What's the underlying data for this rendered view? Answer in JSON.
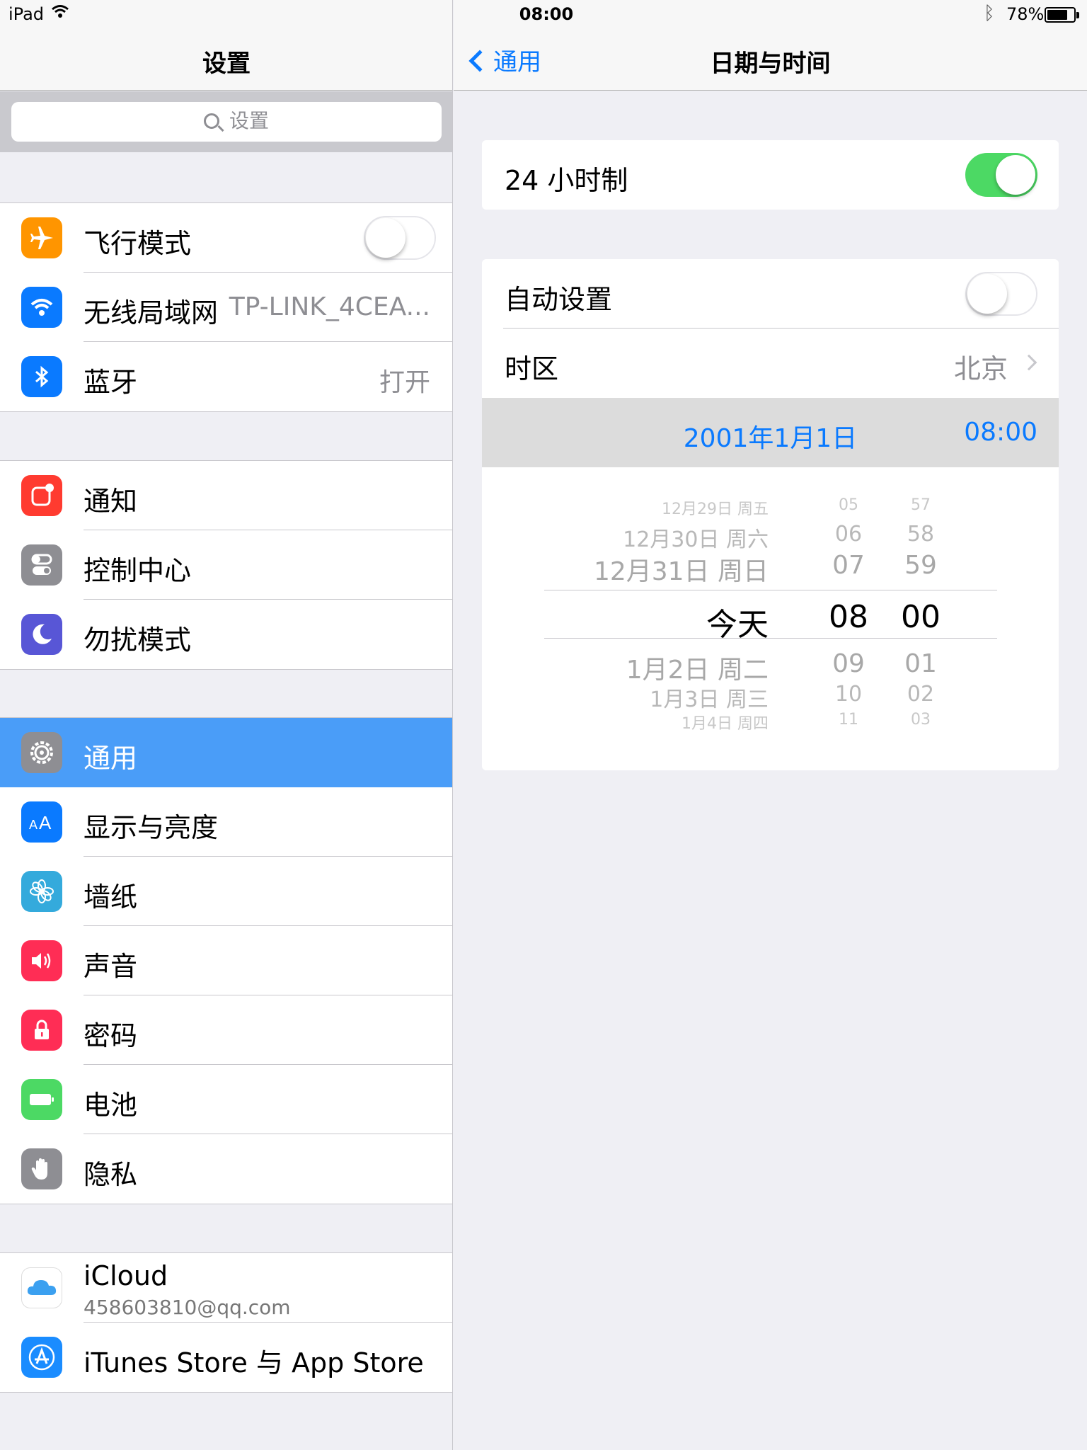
{
  "status_bar": {
    "device": "iPad",
    "time": "08:00",
    "battery_percent": "78%",
    "battery_level": 0.78
  },
  "master": {
    "title": "设置",
    "search_placeholder": "设置",
    "groups": [
      [
        {
          "label": "飞行模式",
          "icon": "airplane-icon",
          "color": "#ff9500",
          "toggle": false
        },
        {
          "label": "无线局域网",
          "icon": "wifi-icon",
          "color": "#0a7aff",
          "value": "TP-LINK_4CEA..."
        },
        {
          "label": "蓝牙",
          "icon": "bluetooth-icon",
          "color": "#0a7aff",
          "value": "打开"
        }
      ],
      [
        {
          "label": "通知",
          "icon": "notifications-icon",
          "color": "#ff3b30"
        },
        {
          "label": "控制中心",
          "icon": "control-center-icon",
          "color": "#8e8e93"
        },
        {
          "label": "勿扰模式",
          "icon": "moon-icon",
          "color": "#5856d6"
        }
      ],
      [
        {
          "label": "通用",
          "icon": "gear-icon",
          "color": "#8e8e93",
          "selected": true
        },
        {
          "label": "显示与亮度",
          "icon": "display-brightness-icon",
          "color": "#0a7aff"
        },
        {
          "label": "墙纸",
          "icon": "wallpaper-flower-icon",
          "color": "#34aadc"
        },
        {
          "label": "声音",
          "icon": "speaker-icon",
          "color": "#ff2d55"
        },
        {
          "label": "密码",
          "icon": "lock-icon",
          "color": "#ff2d55"
        },
        {
          "label": "电池",
          "icon": "battery-icon",
          "color": "#4cd964"
        },
        {
          "label": "隐私",
          "icon": "hand-icon",
          "color": "#8e8e93"
        }
      ],
      [
        {
          "label": "iCloud",
          "icon": "icloud-icon",
          "color": "#ffffff",
          "sublabel": "458603810@qq.com"
        },
        {
          "label": "iTunes Store 与 App Store",
          "icon": "app-store-icon",
          "color": "#1a8cff"
        }
      ]
    ]
  },
  "detail": {
    "back_label": "通用",
    "title": "日期与时间",
    "hour24": {
      "label": "24 小时制",
      "on": true
    },
    "auto_set": {
      "label": "自动设置",
      "on": false
    },
    "timezone": {
      "label": "时区",
      "value": "北京"
    },
    "date_display": "2001年1月1日",
    "time_display": "08:00",
    "picker": {
      "dates": [
        "12月29日 周五",
        "12月30日 周六",
        "12月31日 周日",
        "今天",
        "1月2日 周二",
        "1月3日 周三",
        "1月4日 周四"
      ],
      "hours": [
        "05",
        "06",
        "07",
        "08",
        "09",
        "10",
        "11"
      ],
      "minutes": [
        "57",
        "58",
        "59",
        "00",
        "01",
        "02",
        "03"
      ]
    }
  }
}
